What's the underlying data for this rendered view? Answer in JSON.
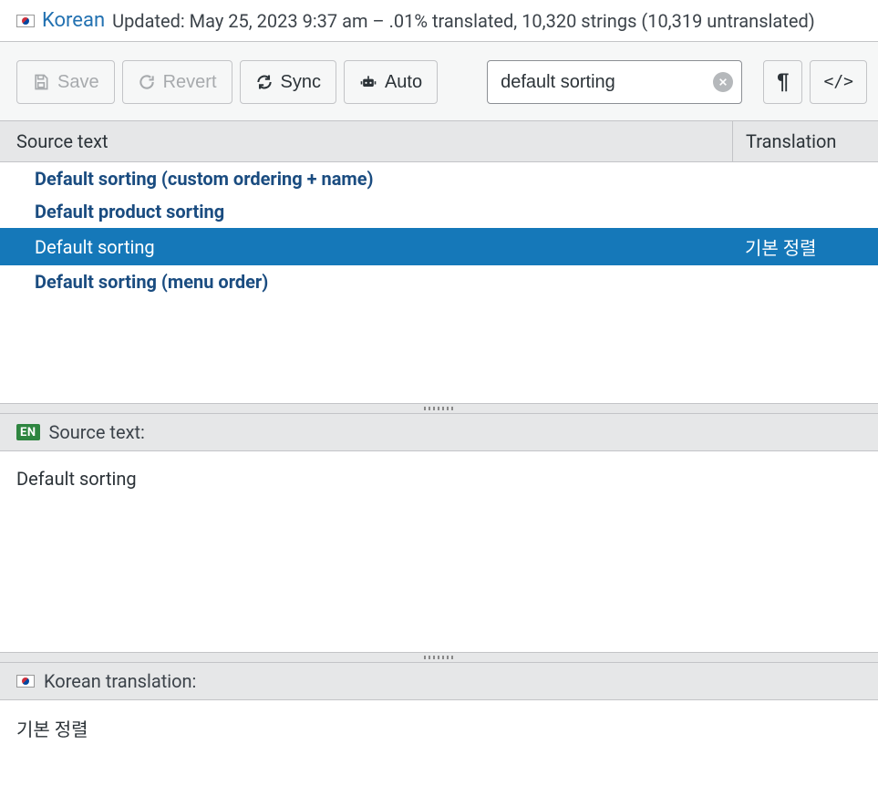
{
  "header": {
    "language": "Korean",
    "meta": "Updated: May 25, 2023 9:37 am – .01% translated, 10,320 strings (10,319 untranslated)"
  },
  "toolbar": {
    "save": "Save",
    "revert": "Revert",
    "sync": "Sync",
    "auto": "Auto"
  },
  "search": {
    "value": "default sorting"
  },
  "columns": {
    "source": "Source text",
    "translation": "Translation"
  },
  "rows": [
    {
      "source": "Default sorting (custom ordering + name)",
      "translation": "",
      "selected": false
    },
    {
      "source": "Default product sorting",
      "translation": "",
      "selected": false
    },
    {
      "source": "Default sorting",
      "translation": "기본 정렬",
      "selected": true
    },
    {
      "source": "Default sorting (menu order)",
      "translation": "",
      "selected": false
    }
  ],
  "source_panel": {
    "label": "Source text:",
    "value": "Default sorting"
  },
  "translation_panel": {
    "label": "Korean translation:",
    "value": "기본 정렬"
  }
}
